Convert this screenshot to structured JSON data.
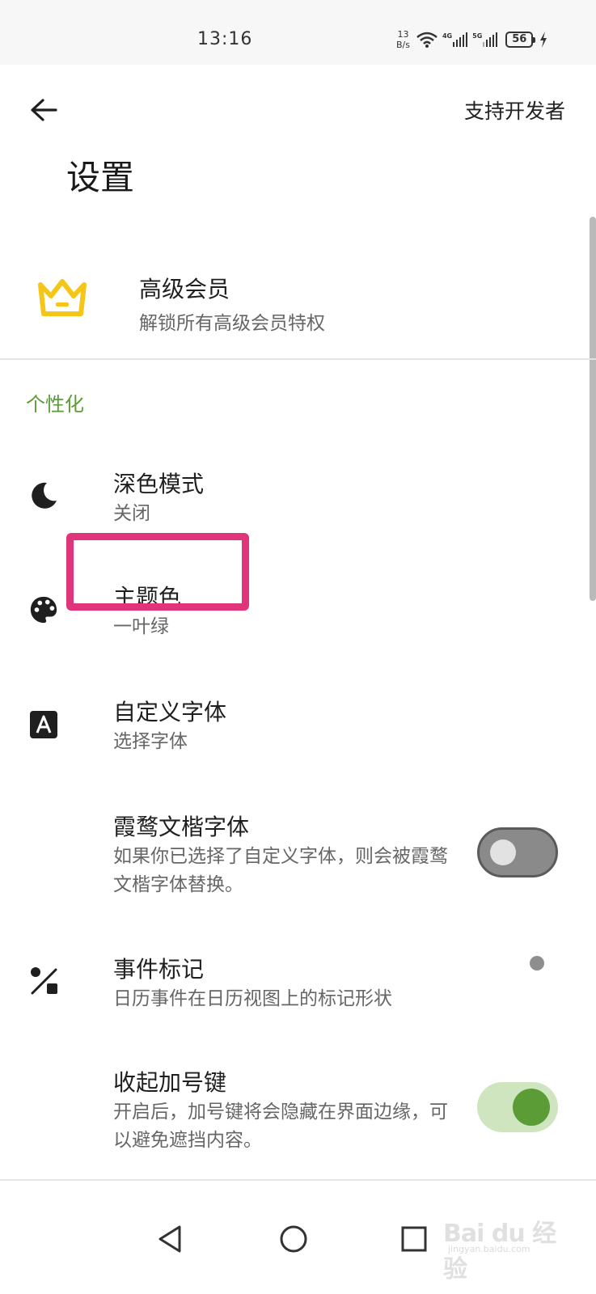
{
  "status_bar": {
    "time": "13:16",
    "net_speed_value": "13",
    "net_speed_unit": "B/s",
    "sim1_label": "4G",
    "sim2_label": "5G",
    "battery": "56"
  },
  "app_bar": {
    "back_icon": "arrow-left-icon",
    "support_label": "支持开发者"
  },
  "page_title": "设置",
  "premium": {
    "icon": "crown-icon",
    "icon_color": "#F5C518",
    "title": "高级会员",
    "subtitle": "解锁所有高级会员特权"
  },
  "section_header": "个性化",
  "accent_color": "#5C9C37",
  "settings": [
    {
      "icon": "moon-icon",
      "title": "深色模式",
      "subtitle": "关闭"
    },
    {
      "icon": "palette-icon",
      "title": "主题色",
      "subtitle": "一叶绿"
    },
    {
      "icon": "font-icon",
      "title": "自定义字体",
      "subtitle": "选择字体"
    },
    {
      "icon": null,
      "title": "霞鹜文楷字体",
      "subtitle": "如果你已选择了自定义字体，则会被霞鹜文楷字体替换。",
      "toggle": false
    },
    {
      "icon": "shapes-icon",
      "title": "事件标记",
      "subtitle": "日历事件在日历视图上的标记形状",
      "indicator": "dot"
    },
    {
      "icon": null,
      "title": "收起加号键",
      "subtitle": "开启后，加号键将会隐藏在界面边缘，可以避免遮挡内容。",
      "toggle": true
    }
  ],
  "nav_bar": [
    "back-triangle-icon",
    "home-circle-icon",
    "recents-square-icon"
  ],
  "watermark": {
    "text": "Bai du 经验",
    "url": "jingyan.baidu.com"
  }
}
